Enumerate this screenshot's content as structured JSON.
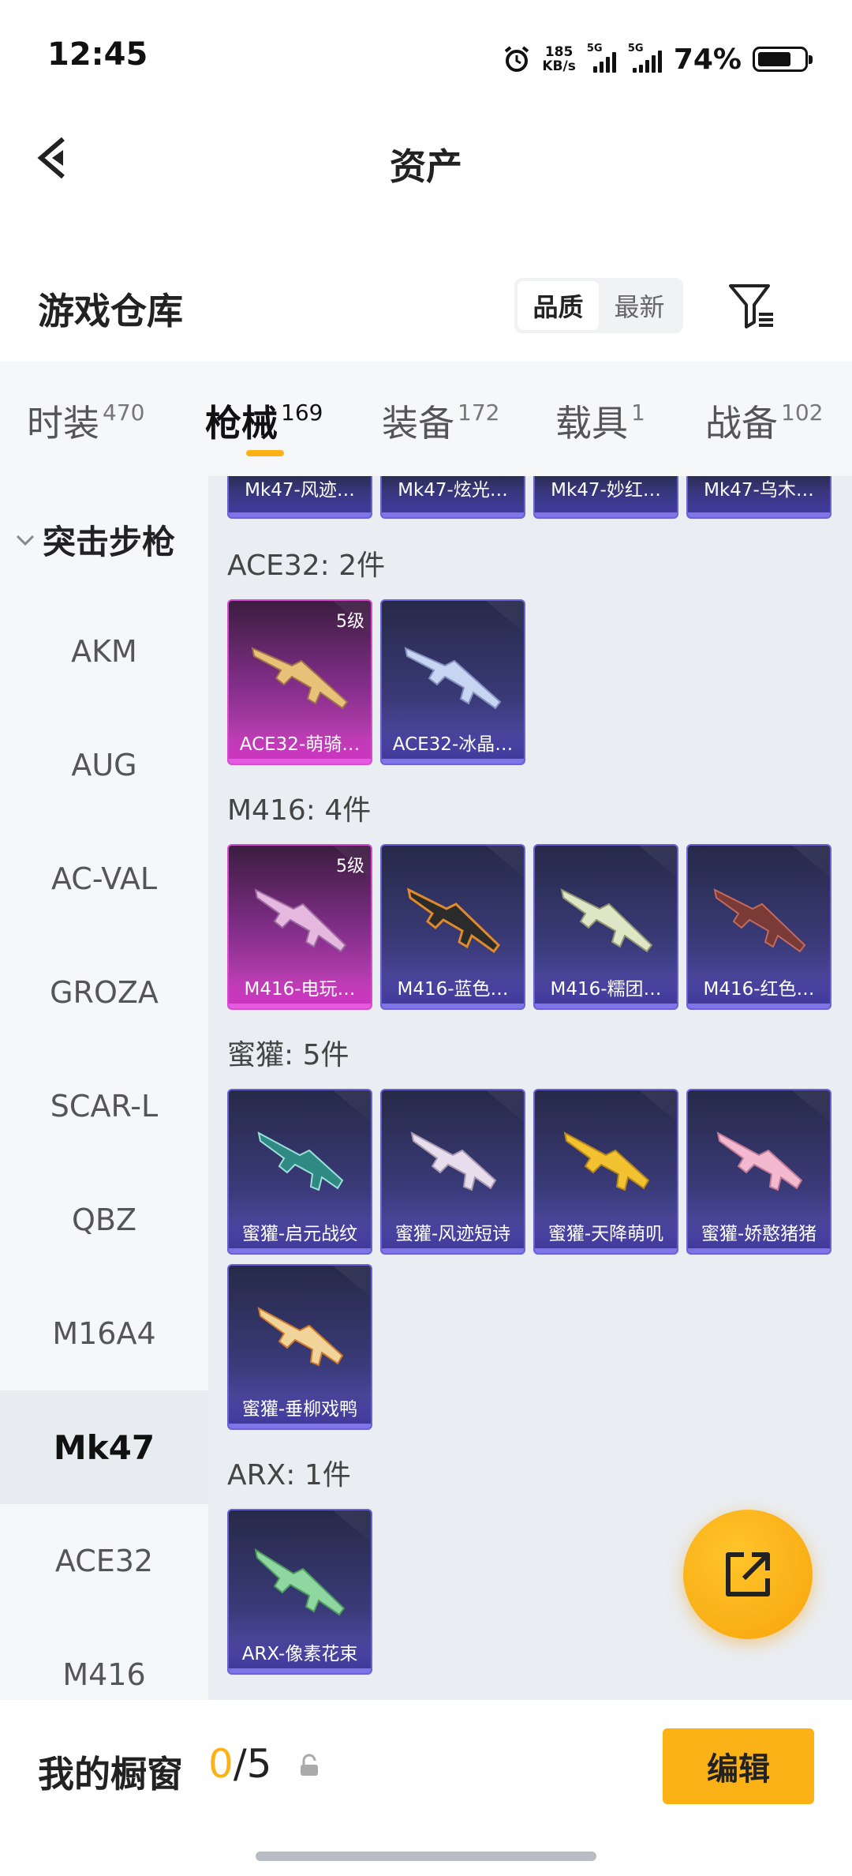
{
  "status_bar": {
    "time": "12:45",
    "net_speed_value": "185",
    "net_speed_unit": "KB/s",
    "signal1_label": "5G",
    "signal2_label": "5G",
    "battery_percent": "74%",
    "battery_level": 0.74
  },
  "header": {
    "title": "资产",
    "back_icon": "chevron-left-icon"
  },
  "warehouse": {
    "title": "游戏仓库",
    "sort_options": [
      "品质",
      "最新"
    ],
    "sort_selected": "品质",
    "filter_icon": "filter-icon"
  },
  "category_tabs": [
    {
      "label": "时装",
      "count": "470",
      "active": false
    },
    {
      "label": "枪械",
      "count": "169",
      "active": true
    },
    {
      "label": "装备",
      "count": "172",
      "active": false
    },
    {
      "label": "载具",
      "count": "1",
      "active": false
    },
    {
      "label": "战备",
      "count": "102",
      "active": false
    }
  ],
  "sidebar": {
    "group_label": "突击步枪",
    "items": [
      "AKM",
      "AUG",
      "AC-VAL",
      "GROZA",
      "SCAR-L",
      "QBZ",
      "M16A4",
      "Mk47",
      "ACE32",
      "M416"
    ],
    "active_item": "Mk47"
  },
  "content": {
    "top_cut_cards": [
      "Mk47-风迹…",
      "Mk47-炫光…",
      "Mk47-妙红…",
      "Mk47-乌木…"
    ],
    "sections": [
      {
        "label": "ACE32: 2件",
        "items": [
          {
            "name": "ACE32-萌骑…",
            "level": "5级",
            "rarity": "gold"
          },
          {
            "name": "ACE32-冰晶…",
            "level": "",
            "rarity": "purple"
          }
        ]
      },
      {
        "label": "M416: 4件",
        "items": [
          {
            "name": "M416-电玩…",
            "level": "5级",
            "rarity": "gold"
          },
          {
            "name": "M416-蓝色…",
            "level": "",
            "rarity": "purple"
          },
          {
            "name": "M416-糯团…",
            "level": "",
            "rarity": "purple"
          },
          {
            "name": "M416-红色…",
            "level": "",
            "rarity": "purple"
          }
        ]
      },
      {
        "label": "蜜獾: 5件",
        "items": [
          {
            "name": "蜜獾-启元战纹",
            "level": "",
            "rarity": "purple"
          },
          {
            "name": "蜜獾-风迹短诗",
            "level": "",
            "rarity": "purple"
          },
          {
            "name": "蜜獾-天降萌叽",
            "level": "",
            "rarity": "purple"
          },
          {
            "name": "蜜獾-娇憨猪猪",
            "level": "",
            "rarity": "purple"
          },
          {
            "name": "蜜獾-垂柳戏鸭",
            "level": "",
            "rarity": "purple"
          }
        ]
      },
      {
        "label": "ARX: 1件",
        "items": [
          {
            "name": "ARX-像素花束",
            "level": "",
            "rarity": "purple"
          }
        ]
      }
    ]
  },
  "fab": {
    "icon": "share-external-icon"
  },
  "bottom_bar": {
    "label": "我的橱窗",
    "current": "0",
    "total_text": "/5",
    "lock_icon": "lock-icon",
    "edit_label": "编辑"
  },
  "colors": {
    "accent": "#fbb216",
    "purple_card": "#574fb6",
    "gold_card": "#d247c2"
  }
}
